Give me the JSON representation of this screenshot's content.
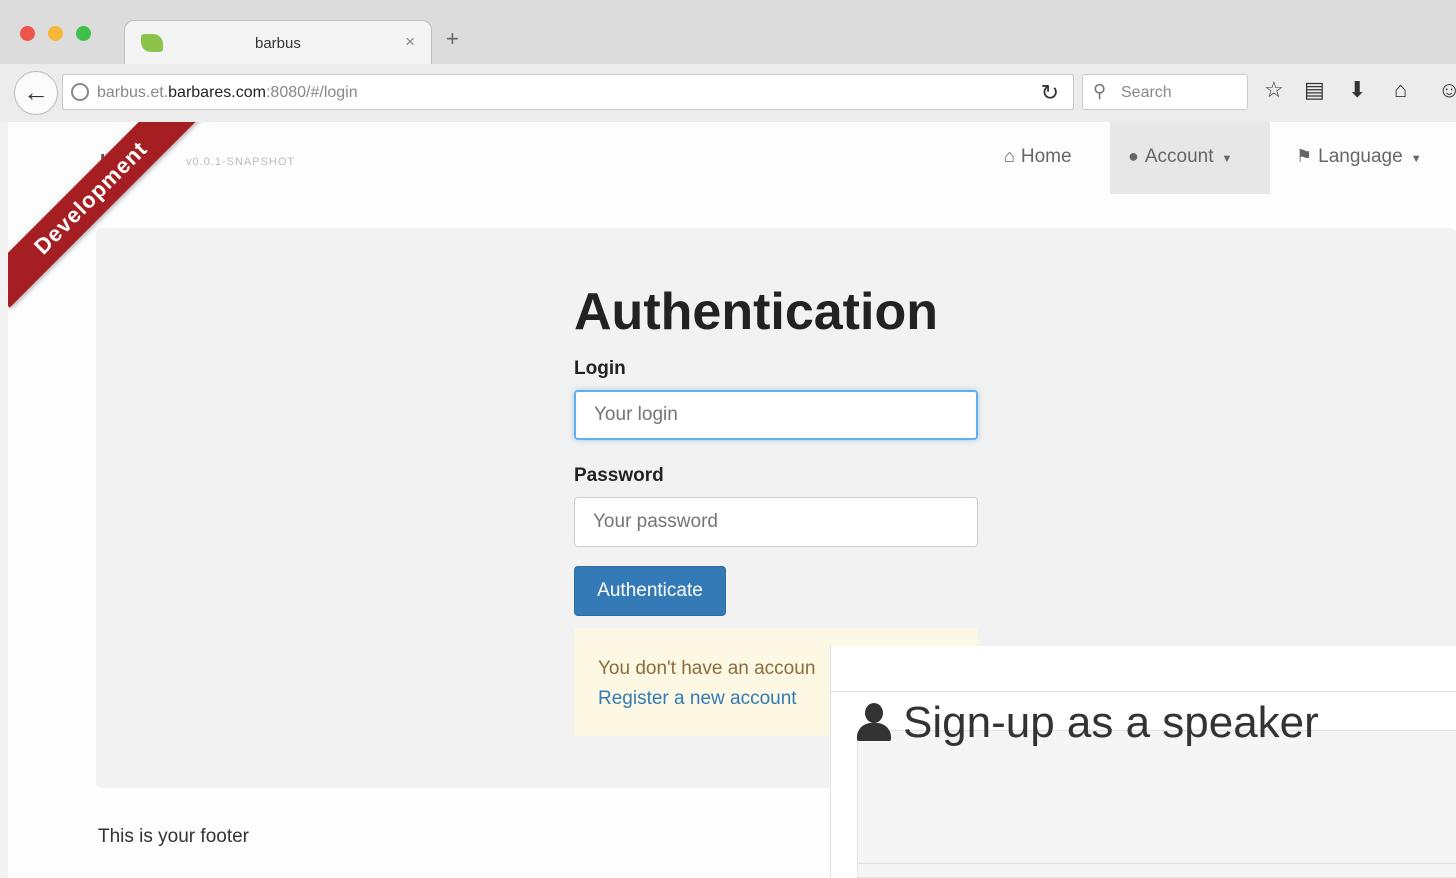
{
  "browser": {
    "tab_title": "barbus",
    "tab_close": "×",
    "new_tab": "+",
    "url_prefix": "barbus.et.",
    "url_domain": "barbares.com",
    "url_suffix": ":8080/#/login",
    "search_placeholder": "Search"
  },
  "app": {
    "brand": "us",
    "version": "v0.0.1-SNAPSHOT",
    "ribbon": "Development",
    "nav": {
      "home": "Home",
      "account": "Account",
      "language": "Language"
    }
  },
  "auth": {
    "title": "Authentication",
    "login_label": "Login",
    "login_placeholder": "Your login",
    "password_label": "Password",
    "password_placeholder": "Your password",
    "submit": "Authenticate",
    "no_account": "You don't have an accoun",
    "register": "Register a new account"
  },
  "footer": "This is your footer",
  "overlay": {
    "title": "Sign-up as a speaker"
  }
}
